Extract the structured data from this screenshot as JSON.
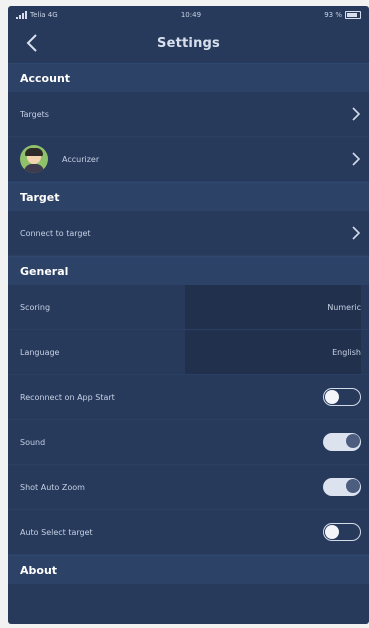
{
  "status_bar": {
    "carrier": "Telia 4G",
    "time": "10:49",
    "battery": "93 %"
  },
  "nav": {
    "title": "Settings",
    "back_icon": "chevron-left-icon"
  },
  "sections": {
    "account": "Account",
    "target": "Target",
    "general": "General",
    "about": "About"
  },
  "account": {
    "targets_label": "Targets",
    "user_name": "Accurizer"
  },
  "target": {
    "connect_label": "Connect to target"
  },
  "general": {
    "scoring_label": "Scoring",
    "scoring_value": "Numeric",
    "language_label": "Language",
    "language_value": "English",
    "reconnect_label": "Reconnect on App Start",
    "reconnect_state": "off",
    "sound_label": "Sound",
    "sound_state": "on",
    "zoom_label": "Shot Auto Zoom",
    "zoom_state": "on",
    "autoselect_label": "Auto Select target",
    "autoselect_state": "off"
  },
  "colors": {
    "background": "#273a5c",
    "section_header": "#2c4266",
    "value_panel": "#20304d"
  }
}
